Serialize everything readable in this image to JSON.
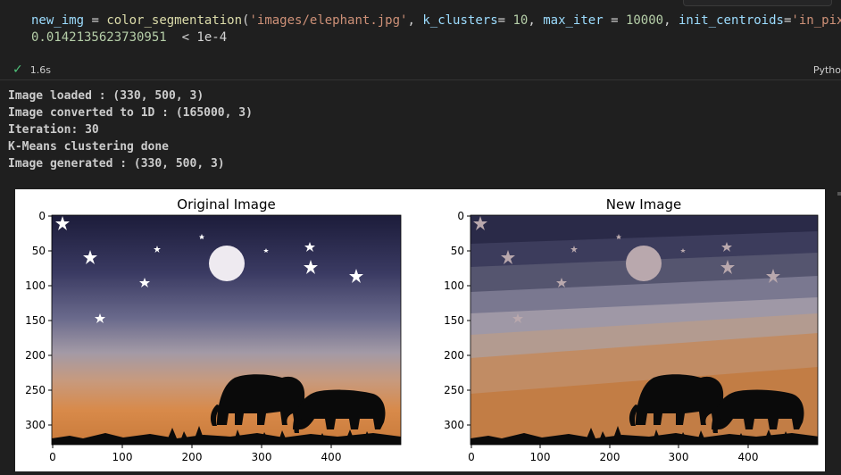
{
  "cell": {
    "code_line1": {
      "var": "new_img",
      "op_assign": " = ",
      "fn": "color_segmentation",
      "paren_open": "(",
      "path": "'images/elephant.jpg'",
      "sep1": ", ",
      "k_name": "k_clusters",
      "k_eq": "= ",
      "k_val": "10",
      "sep2": ", ",
      "iter_name": "max_iter",
      "iter_eq": " = ",
      "iter_val": "10000",
      "sep3": ", ",
      "init_name": "init_centroids",
      "init_eq": "=",
      "init_val": "'in_pixels"
    },
    "code_line2": {
      "value": "0.0142135623730951",
      "rest": "  < 1e-4"
    },
    "status_time": "1.6s",
    "language": "Pytho"
  },
  "output": {
    "lines": [
      "Image loaded : (330, 500, 3)",
      "Image converted to 1D : (165000, 3)",
      "Iteration: 30",
      "K-Means clustering done",
      "Image generated : (330, 500, 3)"
    ]
  },
  "figure": {
    "left_title": "Original Image",
    "right_title": "New Image",
    "y_ticks": [
      "0",
      "50",
      "100",
      "150",
      "200",
      "250",
      "300"
    ],
    "x_ticks": [
      "0",
      "100",
      "200",
      "300",
      "400"
    ]
  }
}
